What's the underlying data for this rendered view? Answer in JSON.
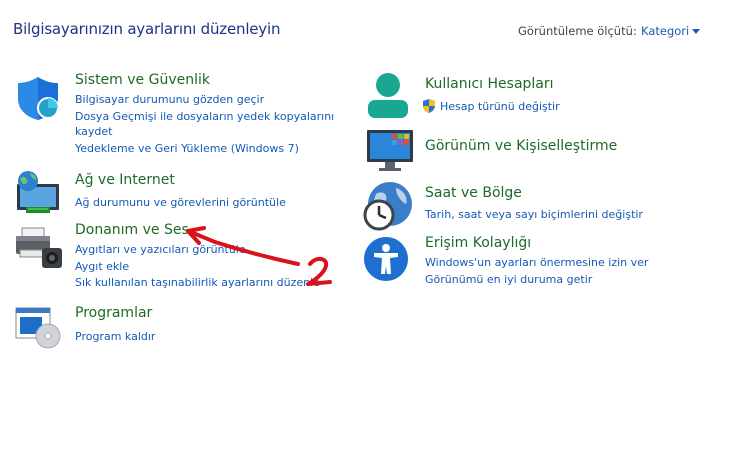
{
  "header": {
    "title": "Bilgisayarınızın ayarlarını düzenleyin",
    "view_by_label": "Görüntüleme ölçütü:",
    "view_by_value": "Kategori"
  },
  "categories": [
    {
      "title": "Sistem ve Güvenlik",
      "icon": "shield-icon",
      "links": [
        "Bilgisayar durumunu gözden geçir",
        "Dosya Geçmişi ile dosyaların yedek kopyalarını",
        "kaydet",
        "Yedekleme ve Geri Yükleme (Windows 7)"
      ]
    },
    {
      "title": "Ağ ve Internet",
      "icon": "network-globe-icon",
      "links": [
        "Ağ durumunu ve görevlerini görüntüle"
      ]
    },
    {
      "title": "Donanım ve Ses",
      "icon": "printer-icon",
      "links": [
        "Aygıtları ve yazıcıları görüntüle",
        "Aygıt ekle",
        "Sık kullanılan taşınabilirlik ayarlarını düzenle"
      ]
    },
    {
      "title": "Programlar",
      "icon": "programs-disc-icon",
      "links": [
        "Program kaldır"
      ]
    },
    {
      "title": "Kullanıcı Hesapları",
      "icon": "user-icon",
      "links": [
        "Hesap türünü değiştir"
      ]
    },
    {
      "title": "Görünüm ve Kişiselleştirme",
      "icon": "monitor-icon",
      "links": []
    },
    {
      "title": "Saat ve Bölge",
      "icon": "clock-globe-icon",
      "links": [
        "Tarih, saat veya sayı biçimlerini değiştir"
      ]
    },
    {
      "title": "Erişim Kolaylığı",
      "icon": "accessibility-icon",
      "links": [
        "Windows'un ayarları önermesine izin ver",
        "Görünümü en iyi duruma getir"
      ]
    }
  ],
  "annotation": {
    "label": "2",
    "color": "#d9121c"
  }
}
